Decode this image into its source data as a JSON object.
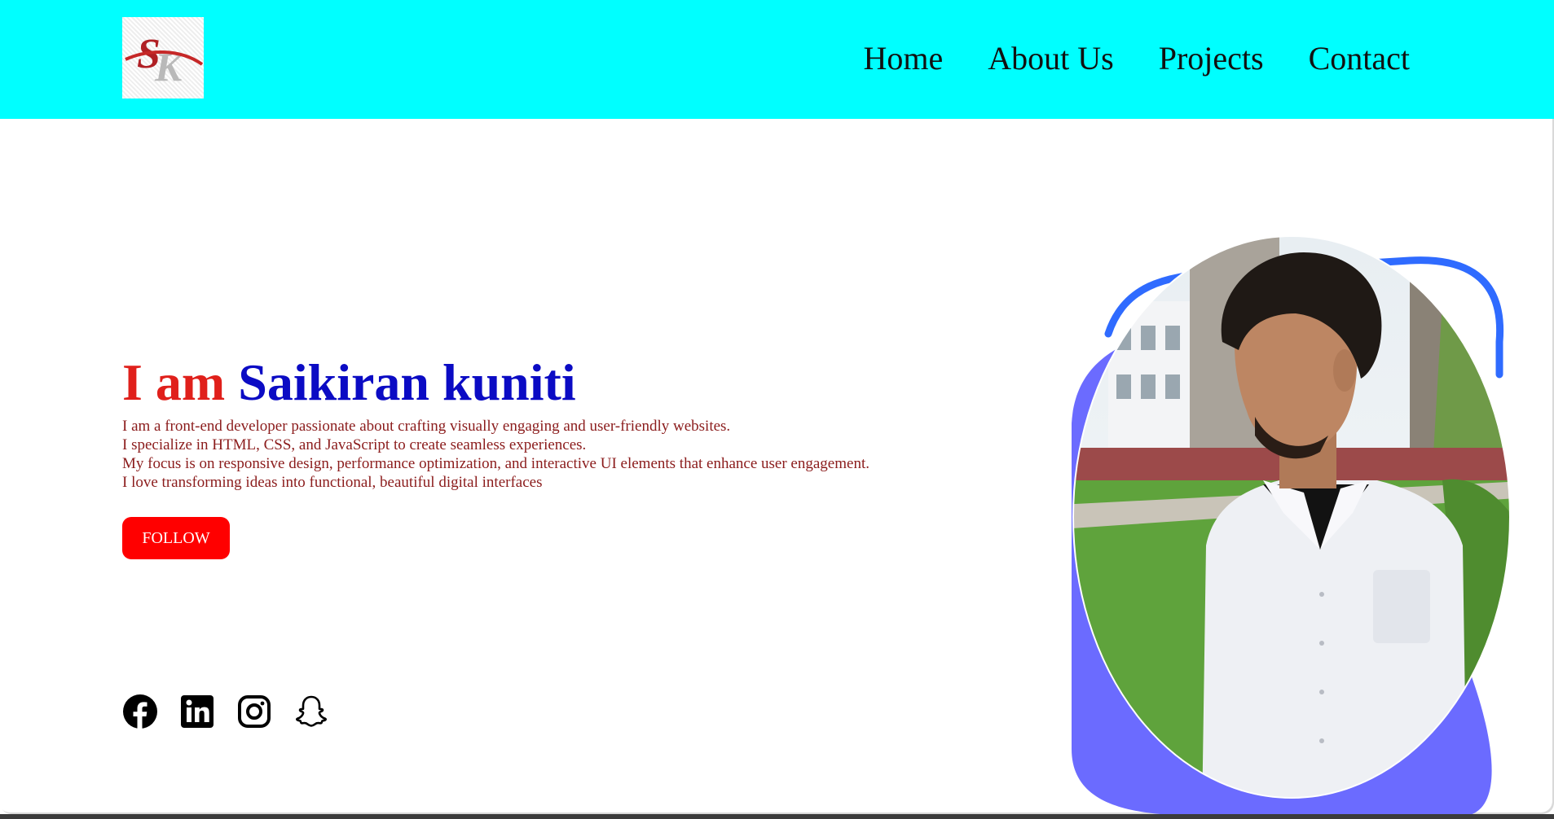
{
  "header": {
    "logo_icon": "sk-logo-icon",
    "nav": [
      {
        "label": "Home"
      },
      {
        "label": "About Us"
      },
      {
        "label": "Projects"
      },
      {
        "label": "Contact"
      }
    ]
  },
  "hero": {
    "title_prefix": "I am",
    "title_name": "Saikiran kuniti",
    "description": [
      "I am a front-end developer passionate about crafting visually engaging and user-friendly websites.",
      "I specialize in HTML, CSS, and JavaScript to create seamless experiences.",
      "My focus is on responsive design, performance optimization, and interactive UI elements that enhance user engagement.",
      "I love transforming ideas into functional, beautiful digital interfaces"
    ],
    "follow_label": "FOLLOW"
  },
  "socials": [
    {
      "icon": "facebook-icon"
    },
    {
      "icon": "linkedin-icon"
    },
    {
      "icon": "instagram-icon"
    },
    {
      "icon": "snapchat-icon"
    }
  ],
  "colors": {
    "header_bg": "#00ffff",
    "title_prefix": "#e0201b",
    "title_name": "#0b0bc4",
    "description": "#8b1c1c",
    "follow_bg": "#ff0000",
    "blob": "#6b6bff",
    "outline": "#2f6bff"
  }
}
